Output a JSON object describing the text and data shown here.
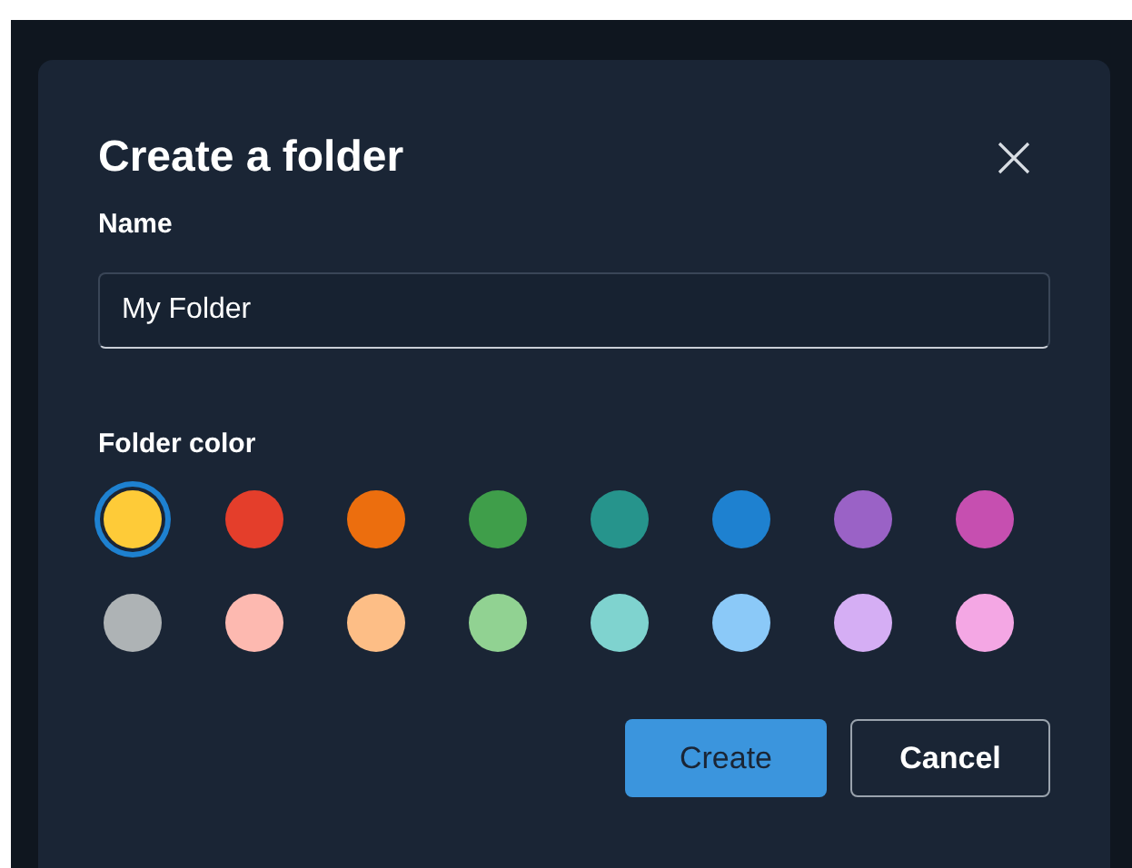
{
  "dialog": {
    "title": "Create a folder",
    "name_field": {
      "label": "Name",
      "value": "My Folder"
    },
    "color_label": "Folder color",
    "colors": [
      {
        "color": "#fecb38",
        "selected": true
      },
      {
        "color": "#e43e2b",
        "selected": false
      },
      {
        "color": "#ec6e0e",
        "selected": false
      },
      {
        "color": "#3f9e4a",
        "selected": false
      },
      {
        "color": "#26948c",
        "selected": false
      },
      {
        "color": "#1e81d0",
        "selected": false
      },
      {
        "color": "#9a62c6",
        "selected": false
      },
      {
        "color": "#c64fb0",
        "selected": false
      },
      {
        "color": "#aeb3b5",
        "selected": false
      },
      {
        "color": "#fdb9b0",
        "selected": false
      },
      {
        "color": "#fdbe86",
        "selected": false
      },
      {
        "color": "#91d292",
        "selected": false
      },
      {
        "color": "#7fd3cf",
        "selected": false
      },
      {
        "color": "#8bc9f8",
        "selected": false
      },
      {
        "color": "#d5aef4",
        "selected": false
      },
      {
        "color": "#f4a7e4",
        "selected": false
      }
    ],
    "buttons": [
      {
        "label": "Create",
        "kind": "primary"
      },
      {
        "label": "Cancel",
        "kind": "secondary"
      }
    ]
  }
}
